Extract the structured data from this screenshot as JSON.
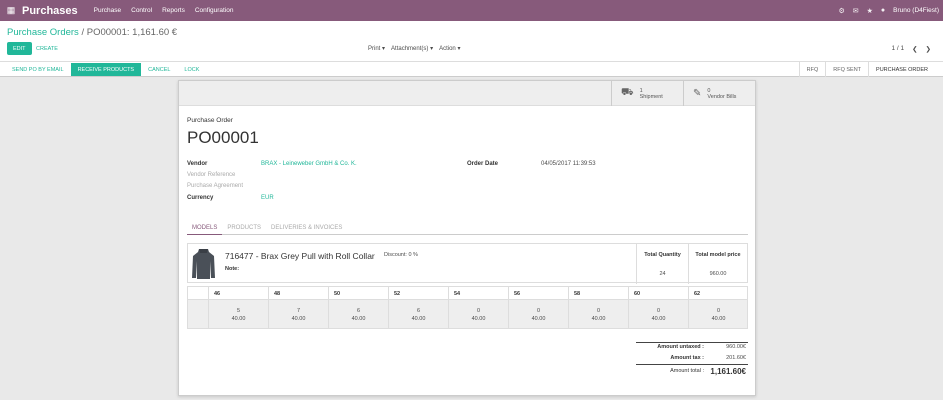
{
  "topbar": {
    "app_title": "Purchases",
    "menu": [
      "Purchase",
      "Control",
      "Reports",
      "Configuration"
    ],
    "user": "Bruno (D4Fiest)"
  },
  "control_panel": {
    "breadcrumb_parent": "Purchase Orders",
    "breadcrumb_sep": "/",
    "breadcrumb_current": "PO00001: 1,161.60 €",
    "edit_label": "EDIT",
    "create_label": "CREATE",
    "print_label": "Print",
    "attachments_label": "Attachment(s)",
    "action_label": "Action",
    "pager": "1 / 1"
  },
  "statusbar": {
    "buttons": [
      "SEND PO BY EMAIL",
      "RECEIVE PRODUCTS",
      "CANCEL",
      "LOCK"
    ],
    "stages": [
      "RFQ",
      "RFQ SENT",
      "PURCHASE ORDER"
    ],
    "active_stage": "PURCHASE ORDER"
  },
  "buttonbox": {
    "shipment_count": "1",
    "shipment_label": "Shipment",
    "bills_count": "0",
    "bills_label": "Vendor Bills"
  },
  "form": {
    "doc_label": "Purchase Order",
    "po_number": "PO00001",
    "vendor_label": "Vendor",
    "vendor_value": "BRAX - Leineweber GmbH & Co. K.",
    "vendor_ref_label": "Vendor Reference",
    "agreement_label": "Purchase Agreement",
    "currency_label": "Currency",
    "currency_value": "EUR",
    "order_date_label": "Order Date",
    "order_date_value": "04/05/2017 11:39:53"
  },
  "tabs": [
    "MODELS",
    "PRODUCTS",
    "DELIVERIES & INVOICES"
  ],
  "model": {
    "name": "716477 - Brax Grey Pull with Roll Collar",
    "discount": "Discount: 0 %",
    "note_label": "Note:",
    "total_qty_label": "Total Quantity",
    "total_qty": "24",
    "total_price_label": "Total model price",
    "total_price": "960.00"
  },
  "size_grid": {
    "sizes": [
      "46",
      "48",
      "50",
      "52",
      "54",
      "56",
      "58",
      "60",
      "62"
    ],
    "quantities": [
      "5",
      "7",
      "6",
      "6",
      "0",
      "0",
      "0",
      "0",
      "0"
    ],
    "prices": [
      "40.00",
      "40.00",
      "40.00",
      "40.00",
      "40.00",
      "40.00",
      "40.00",
      "40.00",
      "40.00"
    ]
  },
  "totals": {
    "untaxed_label": "Amount untaxed :",
    "untaxed": "960.00€",
    "tax_label": "Amount tax :",
    "tax": "201.60€",
    "total_label": "Amount total :",
    "total": "1,161.60€"
  }
}
